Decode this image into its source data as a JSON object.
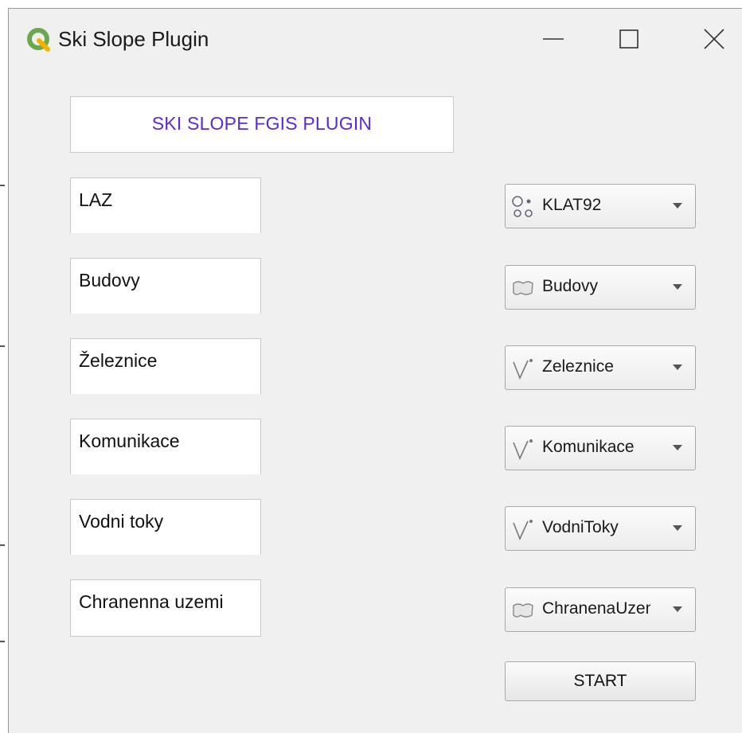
{
  "window": {
    "title": "Ski Slope Plugin",
    "controls": [
      "minimize-icon",
      "maximize-icon",
      "close-icon"
    ]
  },
  "header": {
    "text": "SKI SLOPE FGIS PLUGIN",
    "color": "#5a2bd0"
  },
  "labels": [
    "LAZ",
    "Budovy",
    "Železnice",
    "Komunikace",
    "Vodni toky",
    "Chranenna uzemi"
  ],
  "combos": [
    {
      "icon": "point-layer-icon",
      "value": "KLAT92"
    },
    {
      "icon": "polygon-layer-icon",
      "value": "Budovy"
    },
    {
      "icon": "line-layer-icon",
      "value": "Zeleznice"
    },
    {
      "icon": "line-layer-icon",
      "value": "Komunikace"
    },
    {
      "icon": "line-layer-icon",
      "value": "VodniToky"
    },
    {
      "icon": "polygon-layer-icon",
      "value": "ChranenaUzemi"
    }
  ],
  "start_button": {
    "label": "START"
  },
  "colors": {
    "window_bg": "#f0f0f0",
    "accent": "#5a2bd0",
    "qgis_logo": "#6aa84f"
  }
}
